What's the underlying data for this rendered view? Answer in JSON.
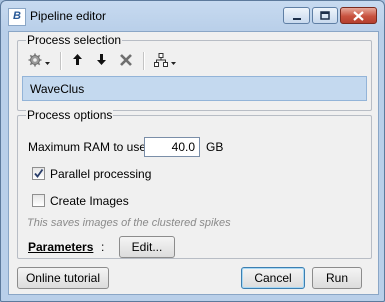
{
  "window": {
    "title": "Pipeline editor",
    "app_icon_text": "B"
  },
  "process_selection": {
    "legend": "Process selection",
    "toolbar": [
      "gear-icon",
      "chevron-down-icon",
      "arrow-up-icon",
      "arrow-down-icon",
      "delete-x-icon",
      "pipeline-tree-icon",
      "chevron-down-icon"
    ],
    "processes": [
      "WaveClus"
    ]
  },
  "process_options": {
    "legend": "Process options",
    "max_ram_label": "Maximum RAM to use:",
    "max_ram_value": "40.0",
    "max_ram_unit": "GB",
    "parallel_label": "Parallel processing",
    "parallel_checked": true,
    "create_images_label": "Create Images",
    "create_images_checked": false,
    "hint": "This saves images of the clustered spikes",
    "parameters_label": "Parameters",
    "parameters_colon": ":",
    "edit_button": "Edit..."
  },
  "footer": {
    "online_tutorial": "Online tutorial",
    "cancel": "Cancel",
    "run": "Run"
  },
  "colors": {
    "selection": "#c4d9ef",
    "close_button": "#c8523f",
    "window_frame": "#b9cfe9"
  }
}
